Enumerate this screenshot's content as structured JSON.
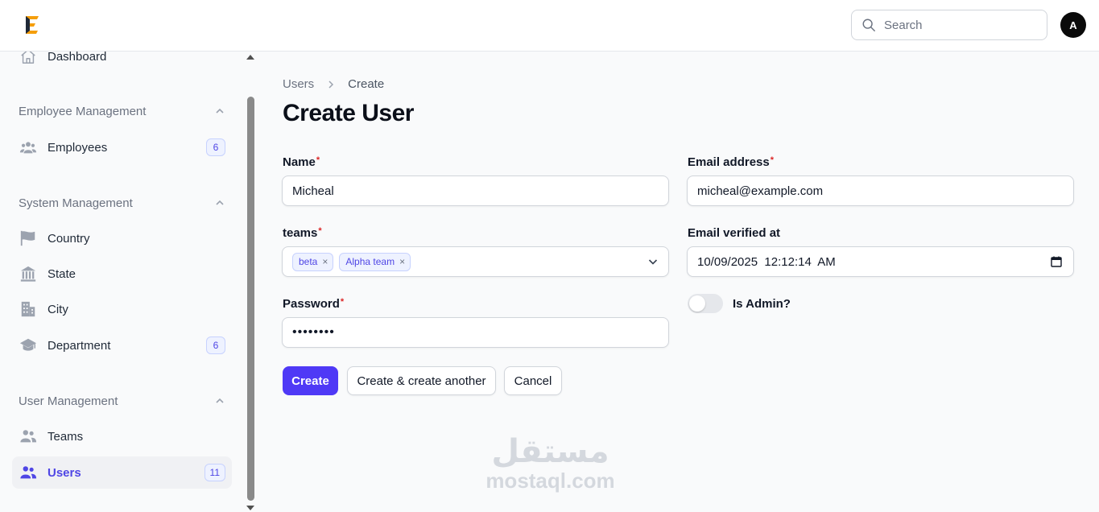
{
  "header": {
    "search_placeholder": "Search",
    "avatar_initial": "A"
  },
  "sidebar": {
    "dashboard": "Dashboard",
    "groups": [
      {
        "label": "Employee Management",
        "items": [
          {
            "label": "Employees",
            "badge": "6"
          }
        ]
      },
      {
        "label": "System Management",
        "items": [
          {
            "label": "Country"
          },
          {
            "label": "State"
          },
          {
            "label": "City"
          },
          {
            "label": "Department",
            "badge": "6"
          }
        ]
      },
      {
        "label": "User Management",
        "items": [
          {
            "label": "Teams"
          },
          {
            "label": "Users",
            "badge": "11",
            "active": true
          }
        ]
      }
    ]
  },
  "breadcrumb": {
    "parent": "Users",
    "current": "Create"
  },
  "page_title": "Create User",
  "form": {
    "name": {
      "label": "Name",
      "value": "Micheal"
    },
    "email": {
      "label": "Email address",
      "value": "micheal@example.com"
    },
    "teams": {
      "label": "teams",
      "tags": [
        "beta",
        "Alpha team"
      ]
    },
    "email_verified_at": {
      "label": "Email verified at",
      "value": "10/09/2025  12:12:14  AM"
    },
    "password": {
      "label": "Password",
      "value": "••••••••"
    },
    "is_admin": {
      "label": "Is Admin?",
      "checked": false
    }
  },
  "actions": {
    "create": "Create",
    "create_another": "Create & create another",
    "cancel": "Cancel"
  },
  "watermark": {
    "arabic": "مستقل",
    "latin": "mostaql.com"
  },
  "colors": {
    "primary": "#4f39f6",
    "accent_text": "#4f46e5",
    "required": "#dc2626"
  }
}
